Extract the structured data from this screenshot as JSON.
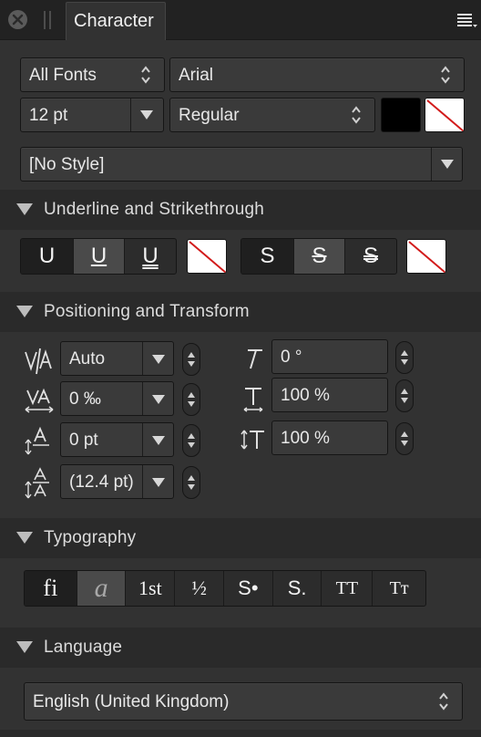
{
  "panel": {
    "tab_label": "Character",
    "menu_icon": "hamburger-menu-icon",
    "close_icon": "close-icon"
  },
  "font": {
    "collection": "All Fonts",
    "family": "Arial",
    "size": "12 pt",
    "weight": "Regular",
    "style": "[No Style]",
    "fill_color": "#000000",
    "stroke_color": "none"
  },
  "sections": {
    "underline": "Underline and Strikethrough",
    "positioning": "Positioning and Transform",
    "typography": "Typography",
    "language": "Language"
  },
  "underline_buttons": [
    "U",
    "U",
    "U"
  ],
  "strike_buttons": [
    "S",
    "S",
    "S"
  ],
  "positioning": {
    "kerning": "Auto",
    "tracking": "0 ‰",
    "baseline": "0 pt",
    "leading": "(12.4 pt)",
    "shear": "0 °",
    "horizontal_scale": "100 %",
    "vertical_scale": "100 %"
  },
  "typography_buttons": [
    "fi",
    "a",
    "1st",
    "½",
    "S•",
    "S.",
    "TT",
    "Tт"
  ],
  "language": {
    "value": "English (United Kingdom)"
  }
}
